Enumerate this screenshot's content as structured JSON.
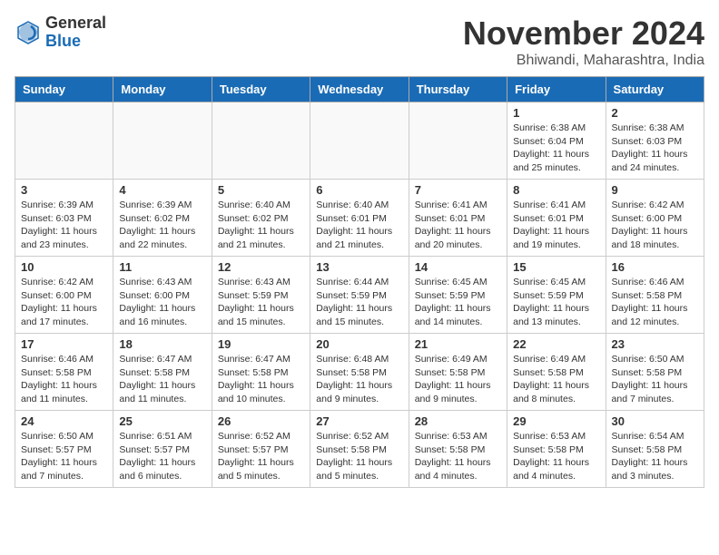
{
  "logo": {
    "general": "General",
    "blue": "Blue"
  },
  "title": "November 2024",
  "location": "Bhiwandi, Maharashtra, India",
  "days_of_week": [
    "Sunday",
    "Monday",
    "Tuesday",
    "Wednesday",
    "Thursday",
    "Friday",
    "Saturday"
  ],
  "weeks": [
    [
      {
        "day": "",
        "info": ""
      },
      {
        "day": "",
        "info": ""
      },
      {
        "day": "",
        "info": ""
      },
      {
        "day": "",
        "info": ""
      },
      {
        "day": "",
        "info": ""
      },
      {
        "day": "1",
        "info": "Sunrise: 6:38 AM\nSunset: 6:04 PM\nDaylight: 11 hours and 25 minutes."
      },
      {
        "day": "2",
        "info": "Sunrise: 6:38 AM\nSunset: 6:03 PM\nDaylight: 11 hours and 24 minutes."
      }
    ],
    [
      {
        "day": "3",
        "info": "Sunrise: 6:39 AM\nSunset: 6:03 PM\nDaylight: 11 hours and 23 minutes."
      },
      {
        "day": "4",
        "info": "Sunrise: 6:39 AM\nSunset: 6:02 PM\nDaylight: 11 hours and 22 minutes."
      },
      {
        "day": "5",
        "info": "Sunrise: 6:40 AM\nSunset: 6:02 PM\nDaylight: 11 hours and 21 minutes."
      },
      {
        "day": "6",
        "info": "Sunrise: 6:40 AM\nSunset: 6:01 PM\nDaylight: 11 hours and 21 minutes."
      },
      {
        "day": "7",
        "info": "Sunrise: 6:41 AM\nSunset: 6:01 PM\nDaylight: 11 hours and 20 minutes."
      },
      {
        "day": "8",
        "info": "Sunrise: 6:41 AM\nSunset: 6:01 PM\nDaylight: 11 hours and 19 minutes."
      },
      {
        "day": "9",
        "info": "Sunrise: 6:42 AM\nSunset: 6:00 PM\nDaylight: 11 hours and 18 minutes."
      }
    ],
    [
      {
        "day": "10",
        "info": "Sunrise: 6:42 AM\nSunset: 6:00 PM\nDaylight: 11 hours and 17 minutes."
      },
      {
        "day": "11",
        "info": "Sunrise: 6:43 AM\nSunset: 6:00 PM\nDaylight: 11 hours and 16 minutes."
      },
      {
        "day": "12",
        "info": "Sunrise: 6:43 AM\nSunset: 5:59 PM\nDaylight: 11 hours and 15 minutes."
      },
      {
        "day": "13",
        "info": "Sunrise: 6:44 AM\nSunset: 5:59 PM\nDaylight: 11 hours and 15 minutes."
      },
      {
        "day": "14",
        "info": "Sunrise: 6:45 AM\nSunset: 5:59 PM\nDaylight: 11 hours and 14 minutes."
      },
      {
        "day": "15",
        "info": "Sunrise: 6:45 AM\nSunset: 5:59 PM\nDaylight: 11 hours and 13 minutes."
      },
      {
        "day": "16",
        "info": "Sunrise: 6:46 AM\nSunset: 5:58 PM\nDaylight: 11 hours and 12 minutes."
      }
    ],
    [
      {
        "day": "17",
        "info": "Sunrise: 6:46 AM\nSunset: 5:58 PM\nDaylight: 11 hours and 11 minutes."
      },
      {
        "day": "18",
        "info": "Sunrise: 6:47 AM\nSunset: 5:58 PM\nDaylight: 11 hours and 11 minutes."
      },
      {
        "day": "19",
        "info": "Sunrise: 6:47 AM\nSunset: 5:58 PM\nDaylight: 11 hours and 10 minutes."
      },
      {
        "day": "20",
        "info": "Sunrise: 6:48 AM\nSunset: 5:58 PM\nDaylight: 11 hours and 9 minutes."
      },
      {
        "day": "21",
        "info": "Sunrise: 6:49 AM\nSunset: 5:58 PM\nDaylight: 11 hours and 9 minutes."
      },
      {
        "day": "22",
        "info": "Sunrise: 6:49 AM\nSunset: 5:58 PM\nDaylight: 11 hours and 8 minutes."
      },
      {
        "day": "23",
        "info": "Sunrise: 6:50 AM\nSunset: 5:58 PM\nDaylight: 11 hours and 7 minutes."
      }
    ],
    [
      {
        "day": "24",
        "info": "Sunrise: 6:50 AM\nSunset: 5:57 PM\nDaylight: 11 hours and 7 minutes."
      },
      {
        "day": "25",
        "info": "Sunrise: 6:51 AM\nSunset: 5:57 PM\nDaylight: 11 hours and 6 minutes."
      },
      {
        "day": "26",
        "info": "Sunrise: 6:52 AM\nSunset: 5:57 PM\nDaylight: 11 hours and 5 minutes."
      },
      {
        "day": "27",
        "info": "Sunrise: 6:52 AM\nSunset: 5:58 PM\nDaylight: 11 hours and 5 minutes."
      },
      {
        "day": "28",
        "info": "Sunrise: 6:53 AM\nSunset: 5:58 PM\nDaylight: 11 hours and 4 minutes."
      },
      {
        "day": "29",
        "info": "Sunrise: 6:53 AM\nSunset: 5:58 PM\nDaylight: 11 hours and 4 minutes."
      },
      {
        "day": "30",
        "info": "Sunrise: 6:54 AM\nSunset: 5:58 PM\nDaylight: 11 hours and 3 minutes."
      }
    ]
  ]
}
